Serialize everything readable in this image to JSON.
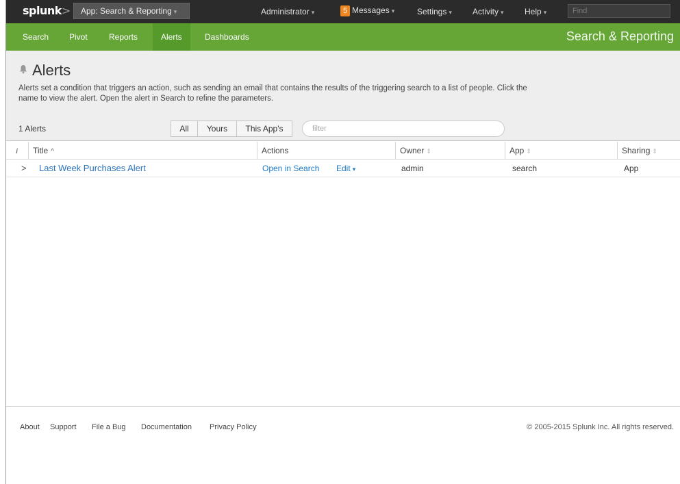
{
  "topbar": {
    "logo_text": "splunk",
    "logo_suffix": ">",
    "app_menu_label": "App: Search & Reporting",
    "items": [
      {
        "label": "Administrator"
      },
      {
        "label": "Messages",
        "badge": "5"
      },
      {
        "label": "Settings"
      },
      {
        "label": "Activity"
      },
      {
        "label": "Help"
      }
    ],
    "find_placeholder": "Find"
  },
  "appbar": {
    "nav": [
      "Search",
      "Pivot",
      "Reports",
      "Alerts",
      "Dashboards"
    ],
    "active": "Alerts",
    "app_title": "Search & Reporting",
    "color": "#65a637"
  },
  "header": {
    "title": "Alerts",
    "icon": "bell-icon",
    "description": "Alerts set a condition that triggers an action, such as sending an email that contains the results of the triggering search to a list of people. Click the name to view the alert. Open the alert in Search to refine the parameters."
  },
  "filterbar": {
    "count": "1 Alerts",
    "segments": [
      "All",
      "Yours",
      "This App's"
    ],
    "filter_placeholder": "filter"
  },
  "table": {
    "columns": {
      "info": "i",
      "title": "Title",
      "actions": "Actions",
      "owner": "Owner",
      "app": "App",
      "sharing": "Sharing"
    },
    "rows": [
      {
        "expand": ">",
        "title": "Last Week Purchases Alert",
        "open_in_search": "Open in Search",
        "edit": "Edit",
        "owner": "admin",
        "app": "search",
        "sharing": "App"
      }
    ]
  },
  "footer": {
    "links": [
      "About",
      "Support",
      "File a Bug",
      "Documentation",
      "Privacy Policy"
    ],
    "copyright": "© 2005-2015 Splunk Inc. All rights reserved."
  }
}
